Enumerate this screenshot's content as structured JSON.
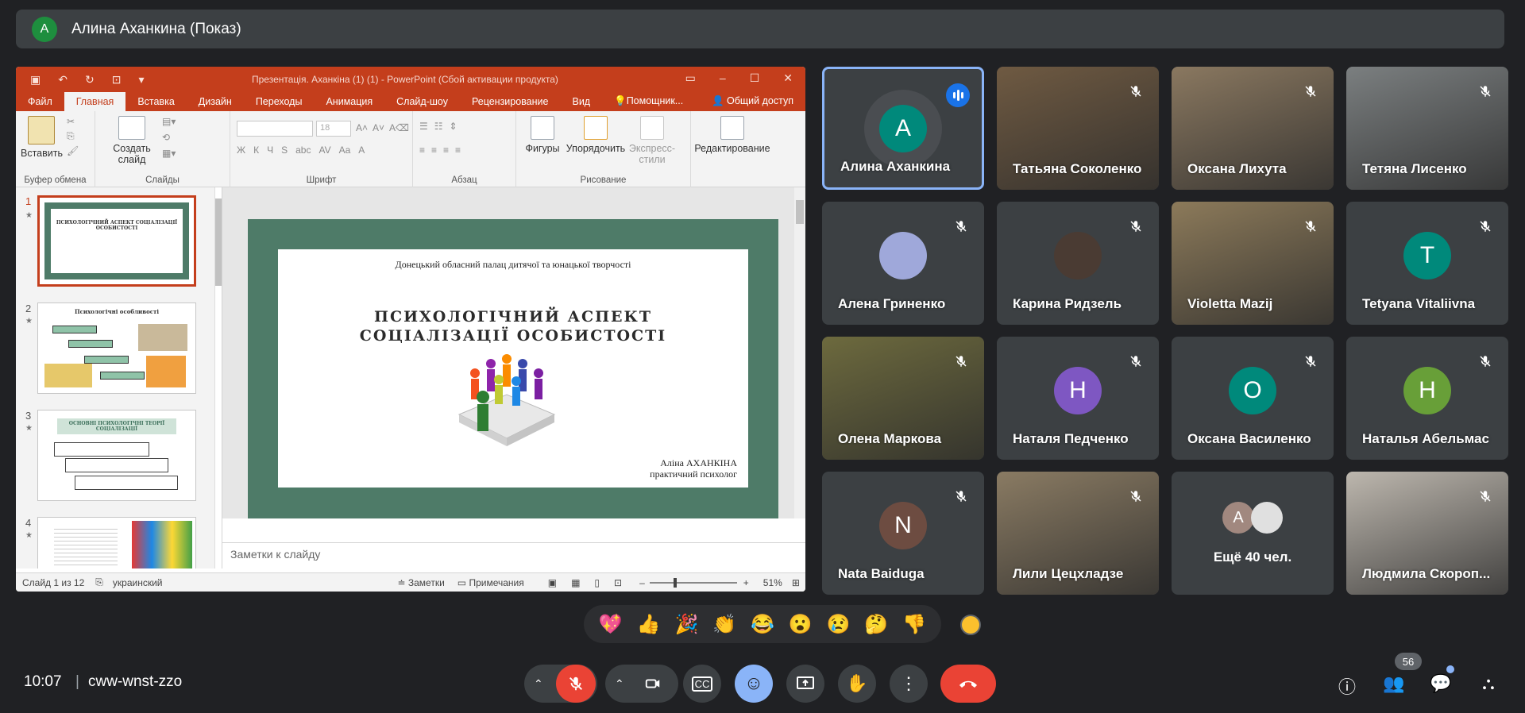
{
  "presenter": {
    "initial": "А",
    "label": "Алина Аханкина (Показ)"
  },
  "powerpoint": {
    "window_title": "Презентація. Аханкіна (1) (1) - PowerPoint (Сбой активации продукта)",
    "tabs": [
      "Файл",
      "Главная",
      "Вставка",
      "Дизайн",
      "Переходы",
      "Анимация",
      "Слайд-шоу",
      "Рецензирование",
      "Вид",
      "Помощник...",
      "Общий доступ"
    ],
    "ribbon": {
      "paste": "Вставить",
      "new_slide": "Создать слайд",
      "font_size": "18",
      "shapes": "Фигуры",
      "arrange": "Упорядочить",
      "styles": "Экспресс-стили",
      "editing": "Редактирование",
      "groups": [
        "Буфер обмена",
        "Слайды",
        "Шрифт",
        "Абзац",
        "Рисование"
      ]
    },
    "thumbs": [
      {
        "num": "1",
        "title": "ПСИХОЛОГІЧНИЙ АСПЕКТ СОЦІАЛІЗАЦІЇ ОСОБИСТОСТІ"
      },
      {
        "num": "2",
        "title": "Психологічні особливості"
      },
      {
        "num": "3",
        "title": "ОСНОВНІ ПСИХОЛОГІЧНІ ТЕОРІЇ СОЦІАЛІЗАЦІЇ"
      },
      {
        "num": "4",
        "title": ""
      }
    ],
    "slide": {
      "org": "Донецький обласний палац дитячої та юнацької творчості",
      "title_line1": "ПСИХОЛОГІЧНИЙ АСПЕКТ",
      "title_line2": "СОЦІАЛІЗАЦІЇ ОСОБИСТОСТІ",
      "author_line1": "Аліна АХАНКІНА",
      "author_line2": "практичний психолог"
    },
    "notes_placeholder": "Заметки к слайду",
    "status": {
      "slide_counter": "Слайд 1 из 12",
      "language": "украинский",
      "notes": "Заметки",
      "comments": "Примечания",
      "zoom": "51%"
    }
  },
  "participants": [
    {
      "name": "Алина Аханкина",
      "type": "avatar",
      "initial": "А",
      "color": "#00897b",
      "speaking": true
    },
    {
      "name": "Татьяна Соколенко",
      "type": "photo",
      "bg": "#6f5a42"
    },
    {
      "name": "Оксана Лихута",
      "type": "photo",
      "bg": "#8a7860"
    },
    {
      "name": "Тетяна Лисенко",
      "type": "photo",
      "bg": "#7b7f80"
    },
    {
      "name": "Алена Гриненко",
      "type": "img-avatar",
      "color": "#9fa8da"
    },
    {
      "name": "Карина Ридзель",
      "type": "img-avatar",
      "color": "#4a3b33"
    },
    {
      "name": "Violetta Mazij",
      "type": "photo",
      "bg": "#8c7a5a"
    },
    {
      "name": "Tetyana Vitaliivna",
      "type": "avatar",
      "initial": "T",
      "color": "#00897b"
    },
    {
      "name": "Олена Маркова",
      "type": "photo",
      "bg": "#6d6a3e"
    },
    {
      "name": "Наталя Педченко",
      "type": "avatar",
      "initial": "H",
      "color": "#7e57c2"
    },
    {
      "name": "Оксана Василенко",
      "type": "avatar",
      "initial": "O",
      "color": "#00897b"
    },
    {
      "name": "Наталья Абельмас",
      "type": "avatar",
      "initial": "H",
      "color": "#689f38"
    },
    {
      "name": "Nata Baiduga",
      "type": "avatar",
      "initial": "N",
      "color": "#6d4c41"
    },
    {
      "name": "Лили Цецхладзе",
      "type": "photo",
      "bg": "#8a7b63"
    },
    {
      "name": "Ещё 40 чел.",
      "type": "more"
    },
    {
      "name": "Людмила Скороп...",
      "type": "photo",
      "bg": "#bdb7ae"
    }
  ],
  "reactions": [
    "💖",
    "👍",
    "🎉",
    "👏",
    "😂",
    "😮",
    "😢",
    "🤔",
    "👎"
  ],
  "meeting": {
    "time": "10:07",
    "separator": "|",
    "code": "cww-wnst-zzo",
    "participant_count": "56"
  }
}
